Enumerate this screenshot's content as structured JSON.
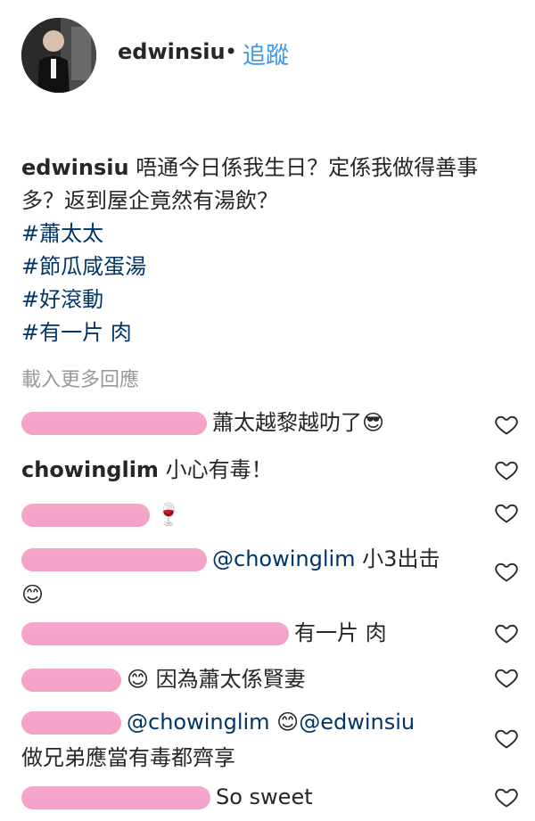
{
  "header": {
    "username": "edwinsiu",
    "separator": "•",
    "follow_label": "追蹤"
  },
  "caption": {
    "username": "edwinsiu",
    "text": "唔通今日係我生日？定係我做得善事多？返到屋企竟然有湯飲？",
    "hashtags": [
      "#蕭太太",
      "#節瓜咸蛋湯",
      "#好滾動",
      "#有一片 肉"
    ]
  },
  "load_more_label": "載入更多回應",
  "comments": [
    {
      "user": "",
      "text": "蕭太越黎越叻了😎"
    },
    {
      "user": "chowinglim",
      "text": "小心有毒！"
    },
    {
      "user": "",
      "text": "🍷"
    },
    {
      "user": "",
      "mention": "@chowinglim",
      "text": " 小3出击 😊"
    },
    {
      "user": "",
      "text": "有一片 肉"
    },
    {
      "user": "",
      "text": "😊 因為蕭太係賢妻"
    },
    {
      "user": "",
      "mention": "@chowinglim",
      "mention2": "@edwinsiu",
      "text_mid": " 😊",
      "text": "做兄弟應當有毒都齊享"
    },
    {
      "user": "",
      "text": "So sweet"
    }
  ],
  "colors": {
    "link": "#3897f0",
    "hashtag": "#003569",
    "redaction": "#f29bc4"
  },
  "icons": {
    "like": "heart-outline-icon"
  }
}
